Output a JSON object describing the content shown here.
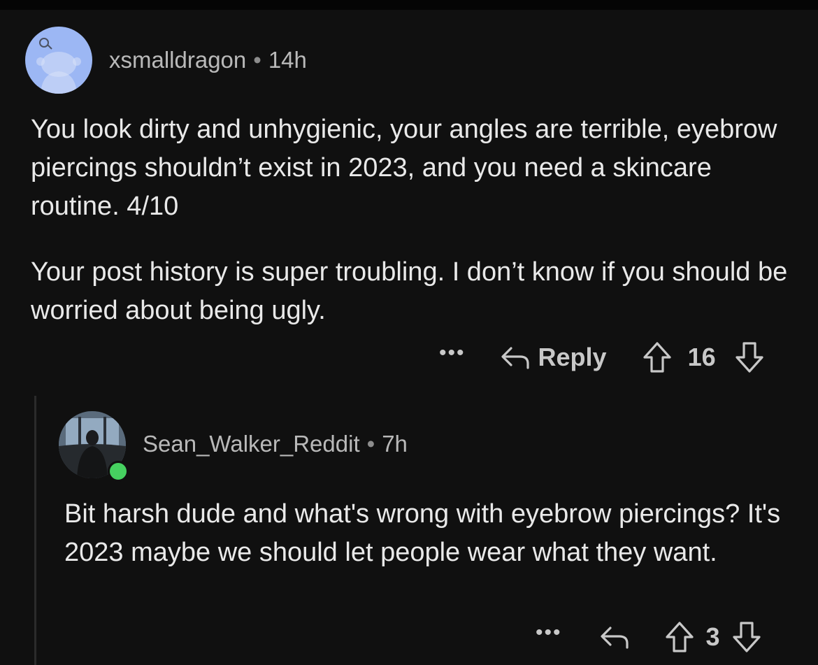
{
  "comments": [
    {
      "username": "xsmalldragon",
      "separator": "•",
      "time": "14h",
      "paragraphs": [
        "You look dirty and unhygienic, your angles are terrible, eyebrow piercings shouldn’t exist in 2023, and you need a skincare routine. 4/10",
        "Your post history is super troubling. I don’t know if you should be worried about being ugly."
      ],
      "more_label": "•••",
      "reply_label": "Reply",
      "score": "16",
      "avatar_color": "#9cb7f4"
    },
    {
      "username": "Sean_Walker_Reddit",
      "separator": "•",
      "time": "7h",
      "paragraphs": [
        "Bit harsh dude and what's wrong with eyebrow piercings? It's 2023 maybe we should let people wear what they want."
      ],
      "more_label": "•••",
      "score": "3",
      "online": true,
      "online_color": "#46d160"
    }
  ],
  "icons": {
    "reply": "reply-arrow-icon",
    "upvote": "upvote-arrow-icon",
    "downvote": "downvote-arrow-icon",
    "more": "more-options-icon"
  }
}
